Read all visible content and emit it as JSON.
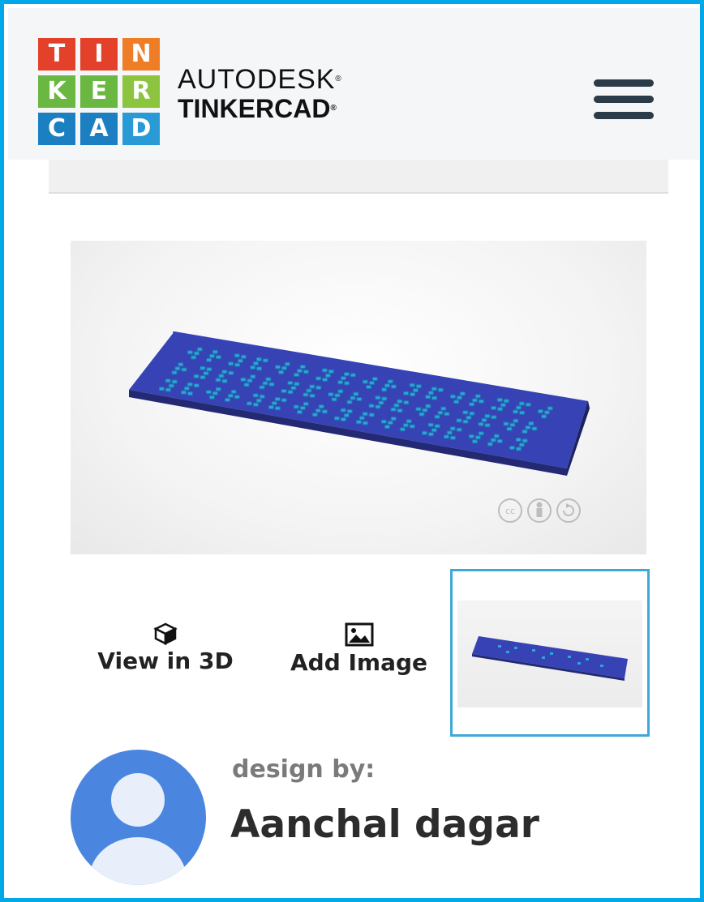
{
  "header": {
    "logo_letters": [
      "T",
      "I",
      "N",
      "K",
      "E",
      "R",
      "C",
      "A",
      "D"
    ],
    "brand_line1": "AUTODESK",
    "brand_line2": "TINKERCAD",
    "registered_mark": "®",
    "menu_icon": "hamburger-menu-icon"
  },
  "license_icons": [
    "cc-icon",
    "attribution-icon",
    "share-alike-icon"
  ],
  "actions": {
    "view3d_label": "View in 3D",
    "view3d_icon": "cube-icon",
    "add_image_label": "Add Image",
    "add_image_icon": "image-icon"
  },
  "designer": {
    "caption": "design by:",
    "name": "Aanchal dagar"
  },
  "colors": {
    "frame": "#00a8e8",
    "thumbnail_border": "#3fa7d9",
    "model_plate": "#3743b5",
    "model_dots": "#2fa4d9",
    "avatar": "#4a86e0"
  }
}
